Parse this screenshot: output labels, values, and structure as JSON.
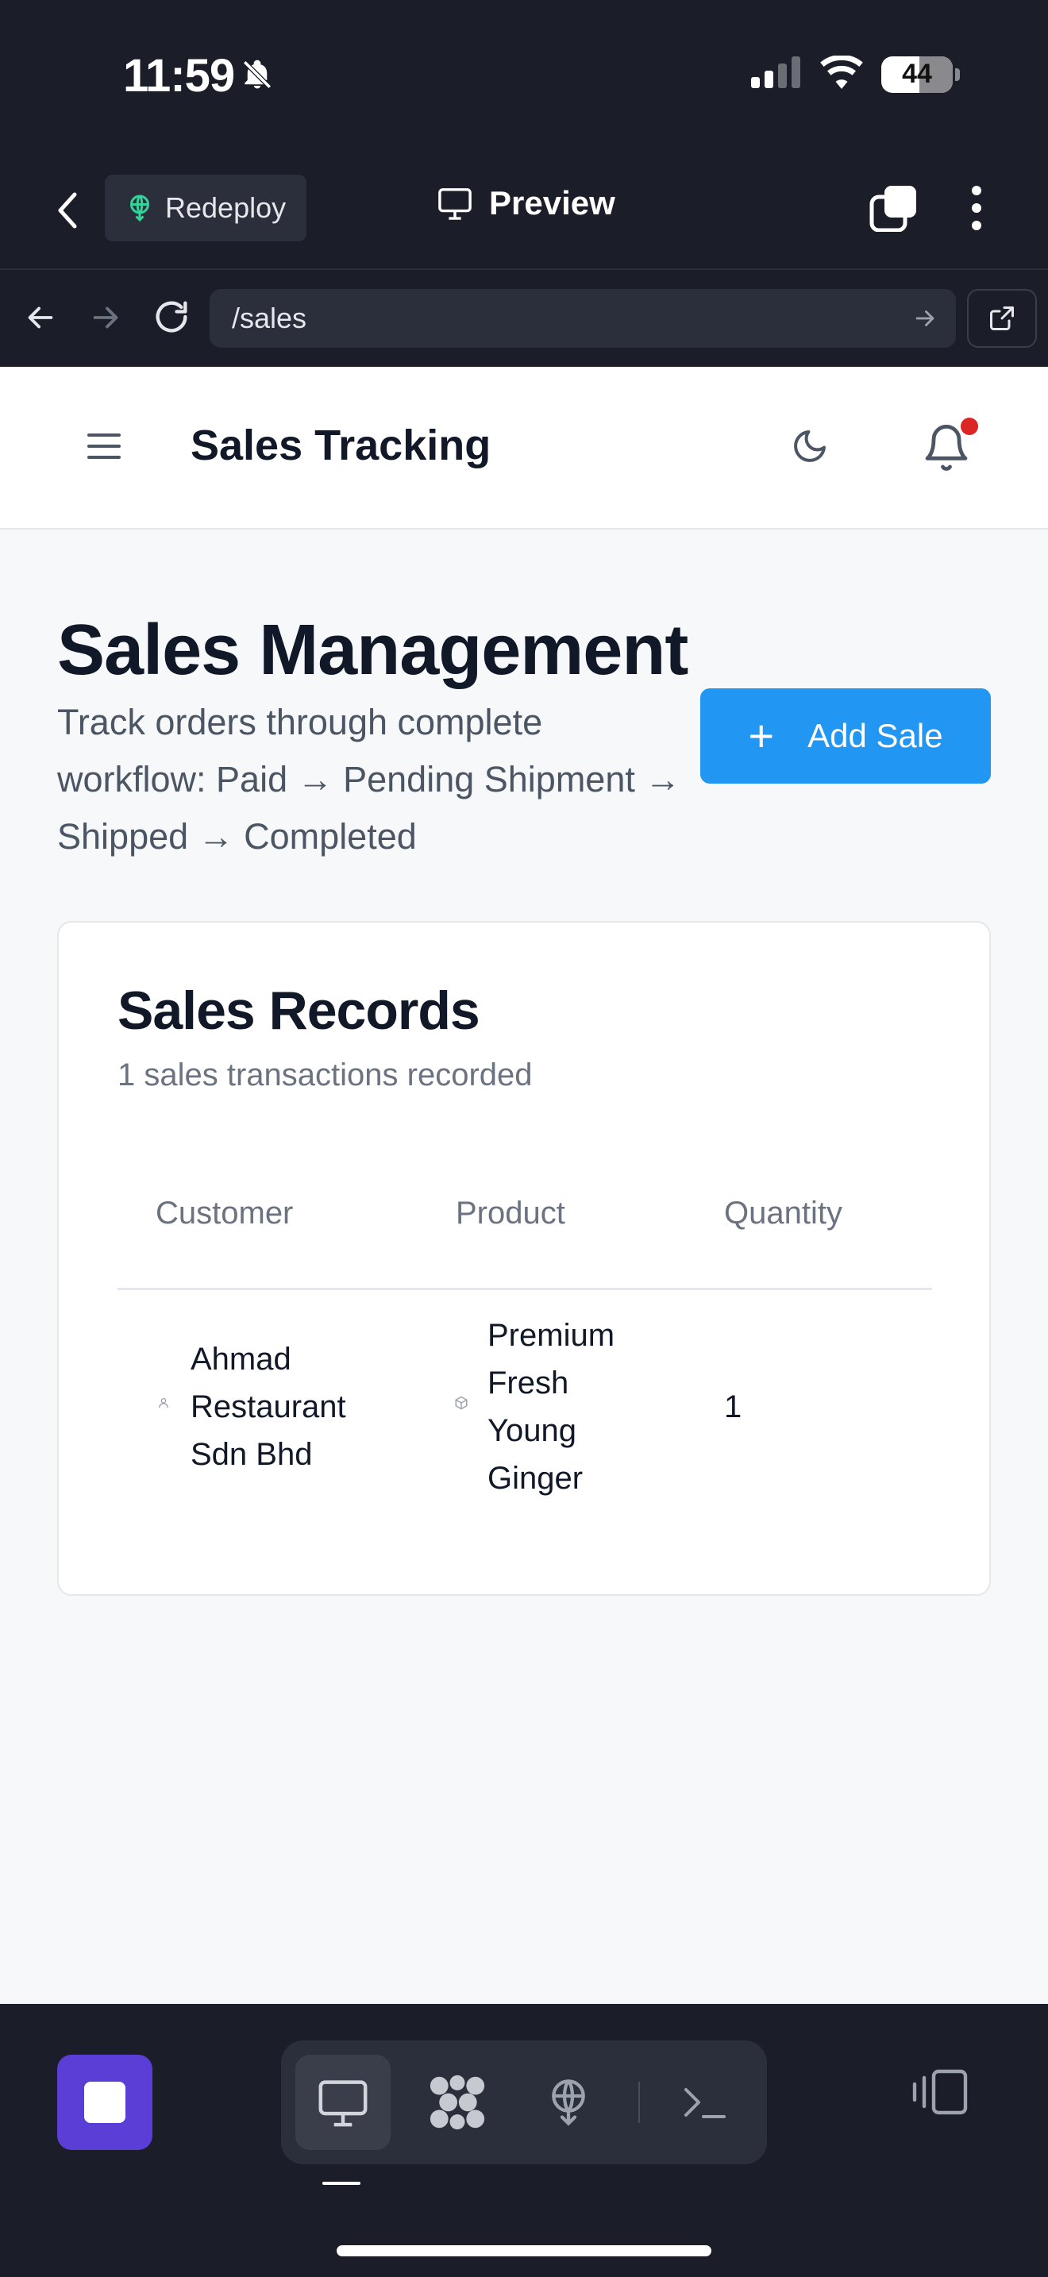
{
  "status_bar": {
    "time": "11:59",
    "battery": "44",
    "icons": [
      "bell-slash-icon",
      "signal-icon",
      "wifi-icon",
      "battery-icon"
    ]
  },
  "top_bar": {
    "redeploy_label": "Redeploy",
    "preview_label": "Preview"
  },
  "url_bar": {
    "url": "/sales"
  },
  "app_header": {
    "title": "Sales Tracking",
    "has_notification": true
  },
  "page": {
    "title": "Sales Management",
    "description": "Track orders through complete workflow: Paid → Pending Shipment → Shipped → Completed",
    "add_button_label": "Add Sale"
  },
  "records_card": {
    "title": "Sales Records",
    "subtitle": "1 sales transactions recorded",
    "columns": [
      "Customer",
      "Product",
      "Quantity"
    ],
    "rows": [
      {
        "customer": "Ahmad Restaurant Sdn Bhd",
        "product": "Premium Fresh Young Ginger",
        "quantity": "1"
      }
    ]
  },
  "colors": {
    "accent": "#2196f3",
    "dark_bg": "#1b1d29",
    "stop_button": "#5b3ed6",
    "notification_dot": "#dc2626"
  }
}
